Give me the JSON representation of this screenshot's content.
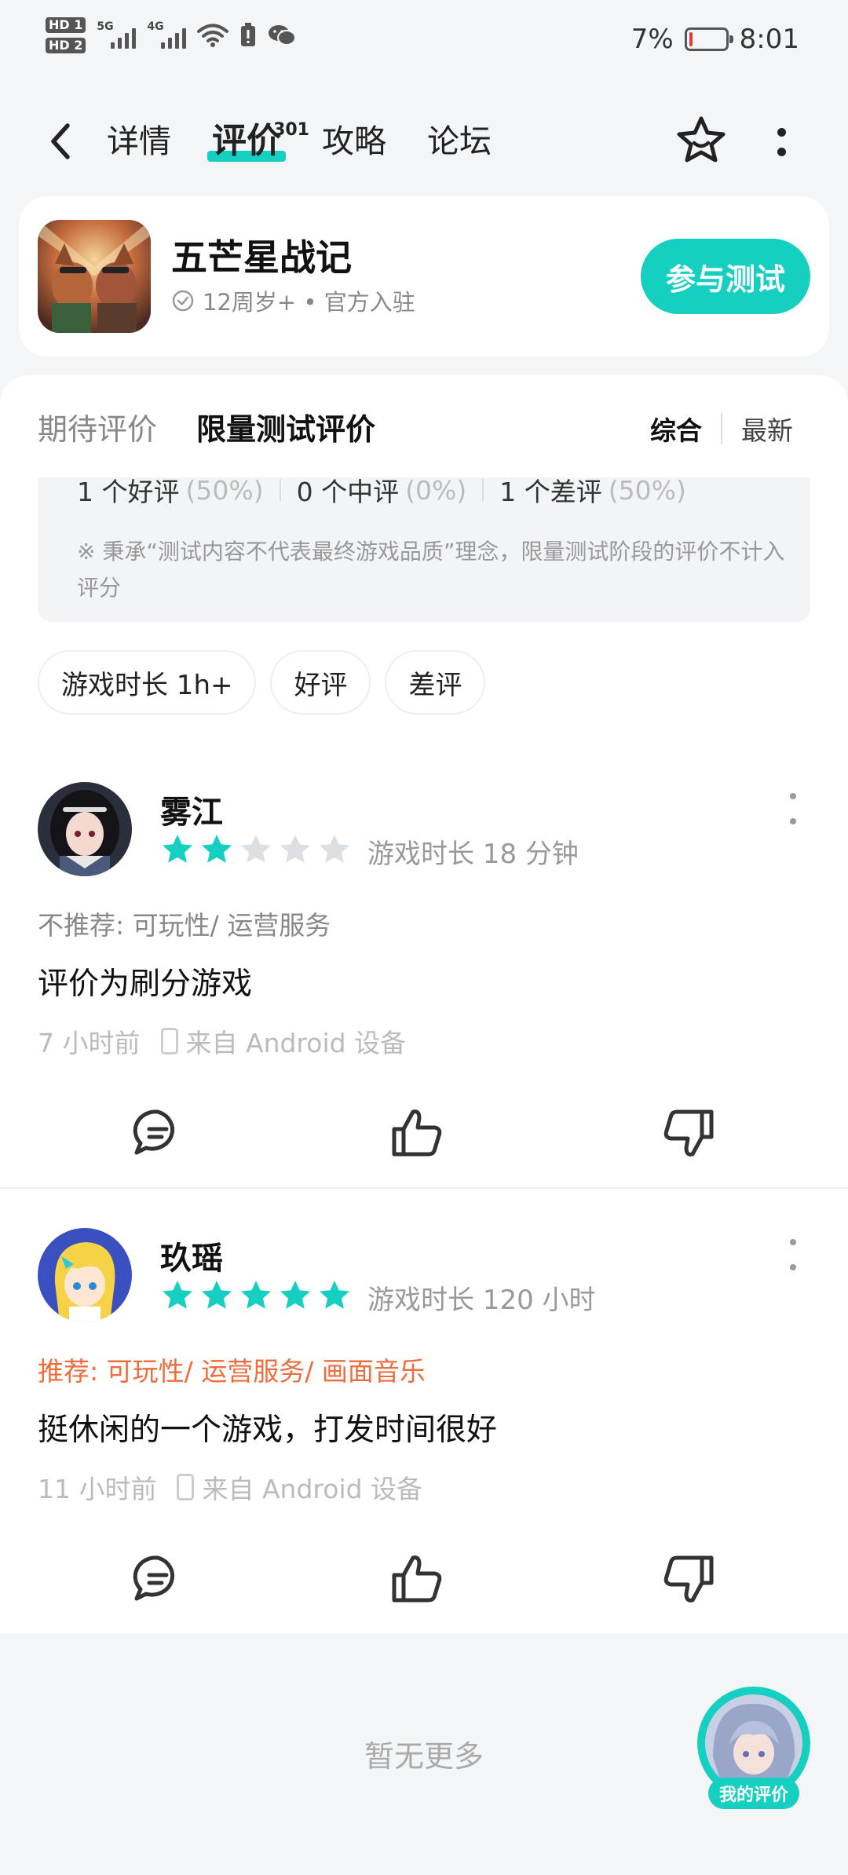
{
  "status_bar": {
    "hd1": "HD 1",
    "hd2": "HD 2",
    "sig1_label": "5G",
    "sig2_label": "4G",
    "battery_pct": "7%",
    "time": "8:01",
    "battery_level": 0.07,
    "battery_color": "#e53935"
  },
  "nav": {
    "tabs": [
      {
        "label": "详情"
      },
      {
        "label": "评价",
        "badge": "301"
      },
      {
        "label": "攻略"
      },
      {
        "label": "论坛"
      }
    ],
    "active_tab_index": 1,
    "accent": "#15d0c0"
  },
  "game": {
    "title": "五芒星战记",
    "meta": "12周岁+ • 官方入驻",
    "join_label": "参与测试"
  },
  "review_tabs": {
    "tab1": "期待评价",
    "tab2": "限量测试评价",
    "sort_comprehensive": "综合",
    "sort_latest": "最新"
  },
  "summary": {
    "good": "1 个好评",
    "good_pct": "(50%)",
    "mid": "0 个中评",
    "mid_pct": "(0%)",
    "bad": "1 个差评",
    "bad_pct": "(50%)",
    "note": "※ 秉承“测试内容不代表最终游戏品质”理念，限量测试阶段的评价不计入评分"
  },
  "filters": [
    "游戏时长 1h+",
    "好评",
    "差评"
  ],
  "reviews": [
    {
      "name": "雾江",
      "rating": 2,
      "playtime": "游戏时长 18 分钟",
      "tags": "不推荐: 可玩性/ 运营服务",
      "text": "评价为刷分游戏",
      "time": "7 小时前",
      "device": "来自 Android 设备"
    },
    {
      "name": "玖瑶",
      "rating": 5,
      "playtime": "游戏时长 120 小时",
      "tags": "推荐: 可玩性/ 运营服务/ 画面音乐",
      "text": "挺休闲的一个游戏，打发时间很好",
      "time": "11 小时前",
      "device": "来自 Android 设备"
    }
  ],
  "footer": {
    "no_more": "暂无更多",
    "my_review": "我的评价"
  },
  "icons": {
    "back": "chevron-left-icon",
    "favorite": "star-outline-icon",
    "more": "more-vertical-icon",
    "comment": "comment-icon",
    "like": "thumbs-up-icon",
    "dislike": "thumbs-down-icon"
  }
}
